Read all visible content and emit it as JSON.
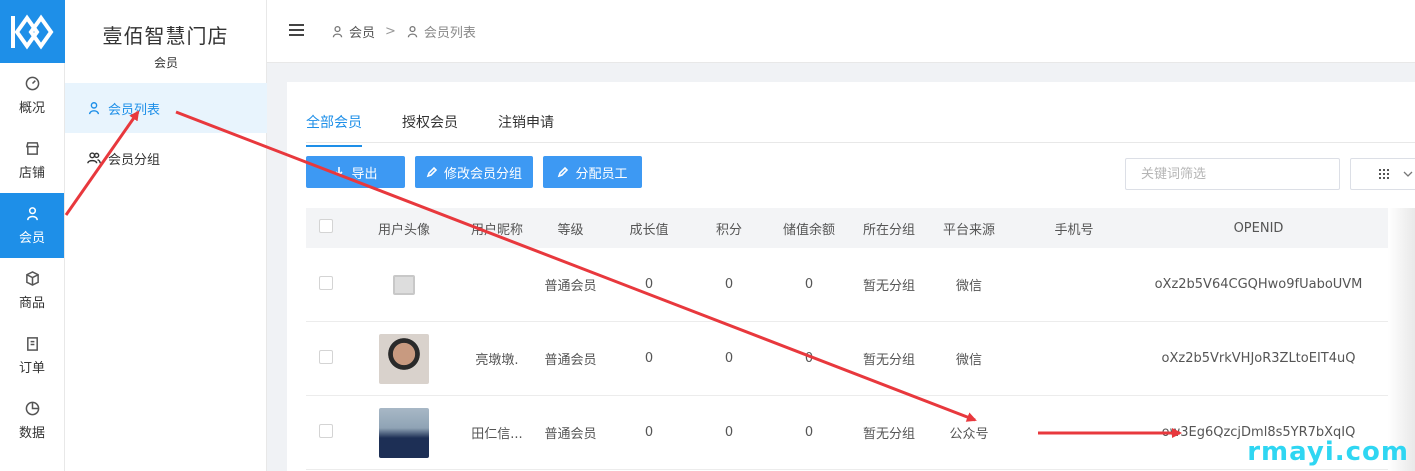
{
  "brand": {
    "color": "#1e8fe8",
    "logo_icon": "double-ring-logo-icon"
  },
  "rail": {
    "items": [
      {
        "label": "概况",
        "icon": "dashboard-icon"
      },
      {
        "label": "店铺",
        "icon": "shop-icon"
      },
      {
        "label": "会员",
        "icon": "user-icon",
        "active": true
      },
      {
        "label": "商品",
        "icon": "box-icon"
      },
      {
        "label": "订单",
        "icon": "order-icon"
      },
      {
        "label": "数据",
        "icon": "pie-chart-icon"
      }
    ]
  },
  "sub": {
    "store_name": "壹佰智慧门店",
    "caption": "会员",
    "items": [
      {
        "label": "会员列表",
        "icon": "user-icon",
        "active": true
      },
      {
        "label": "会员分组",
        "icon": "users-icon"
      }
    ]
  },
  "header": {
    "breadcrumb": [
      "会员",
      "会员列表"
    ],
    "separator": ">"
  },
  "tabs": [
    "全部会员",
    "授权会员",
    "注销申请"
  ],
  "toolbar": {
    "export": "导出",
    "edit_group": "修改会员分组",
    "assign_staff": "分配员工",
    "search_placeholder": "关键词筛选"
  },
  "table": {
    "columns": [
      "用户头像",
      "用户昵称",
      "等级",
      "成长值",
      "积分",
      "储值余额",
      "所在分组",
      "平台来源",
      "手机号",
      "OPENID"
    ],
    "rows": [
      {
        "nickname": "",
        "level": "普通会员",
        "growth": "0",
        "points": "0",
        "balance": "0",
        "group": "暂无分组",
        "source": "微信",
        "phone": "",
        "openid": "oXz2b5V64CGQHwo9fUaboUVM"
      },
      {
        "nickname": "亮墩墩.",
        "level": "普通会员",
        "growth": "0",
        "points": "0",
        "balance": "0",
        "group": "暂无分组",
        "source": "微信",
        "phone": "",
        "openid": "oXz2b5VrkVHJoR3ZLtoEIT4uQ"
      },
      {
        "nickname": "田仁信...",
        "level": "普通会员",
        "growth": "0",
        "points": "0",
        "balance": "0",
        "group": "暂无分组",
        "source": "公众号",
        "phone": "",
        "openid": "ow3Eg6QzcjDml8s5YR7bXqIQ"
      }
    ]
  },
  "watermark": "rmayi.com",
  "annotation_color": "#e8383d"
}
